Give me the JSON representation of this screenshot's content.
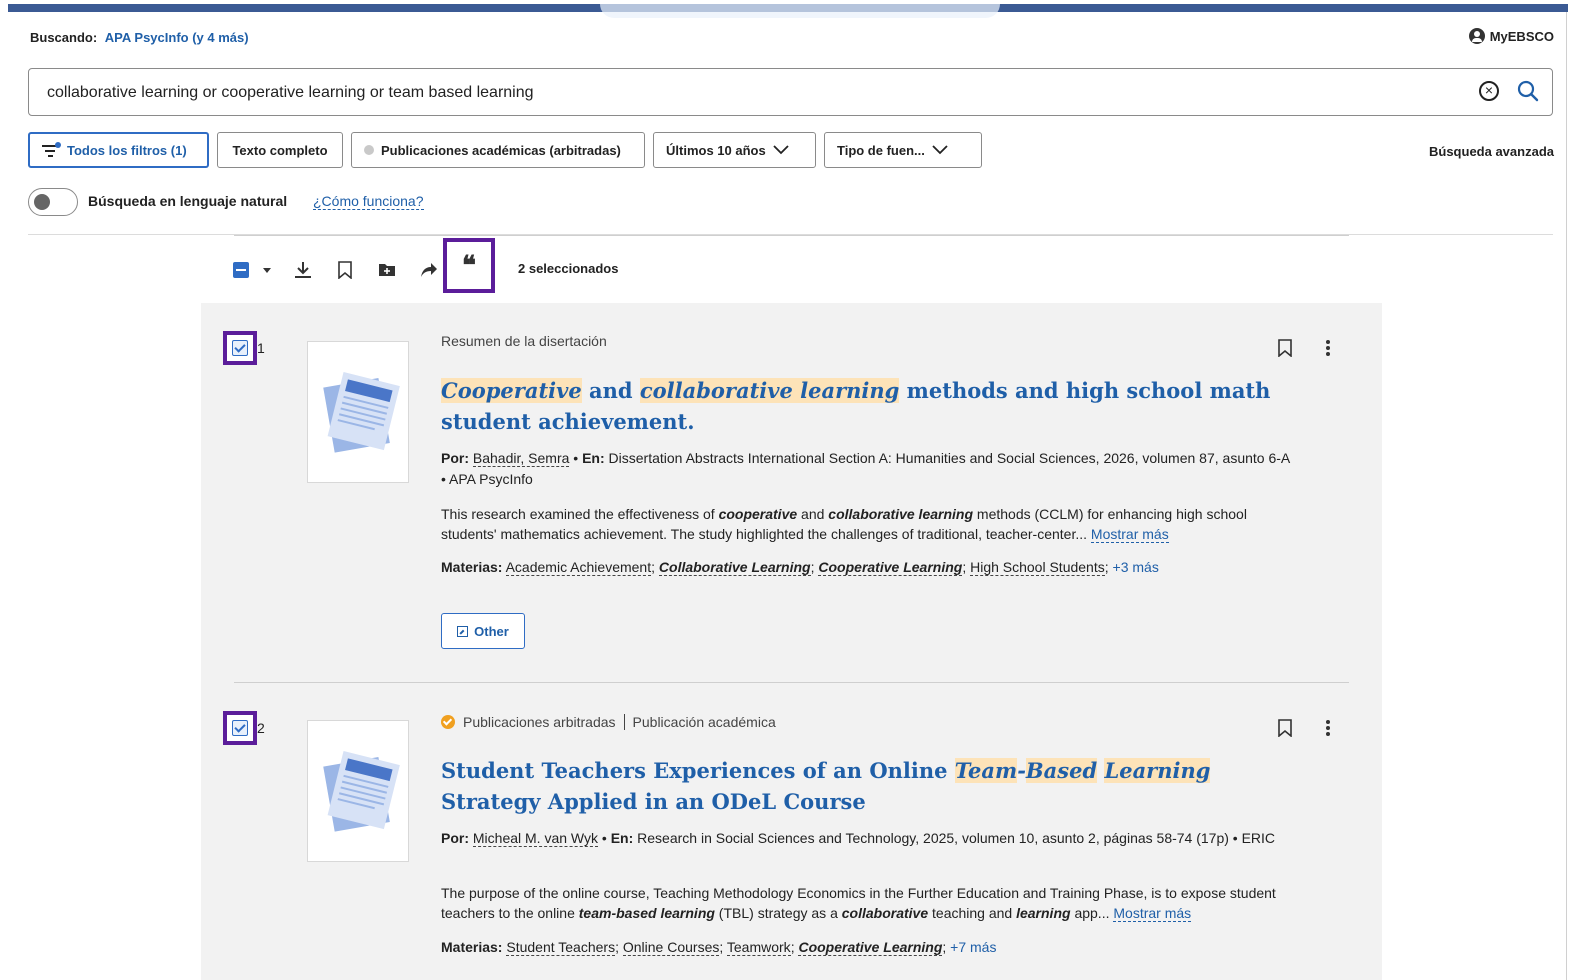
{
  "header": {
    "searching_label": "Buscando:",
    "databases": "APA PsycInfo (y 4 más)",
    "account": "MyEBSCO"
  },
  "search": {
    "query": "collaborative learning or cooperative learning or team based learning"
  },
  "filters": {
    "all_filters": "Todos los filtros (1)",
    "full_text": "Texto completo",
    "peer_reviewed": "Publicaciones académicas (arbitradas)",
    "date_range": "Últimos 10 años",
    "source_type": "Tipo de fuen...",
    "advanced_search": "Búsqueda avanzada"
  },
  "natural_language": {
    "label": "Búsqueda en lenguaje natural",
    "help_link": "¿Cómo funciona?"
  },
  "toolbar": {
    "cite_glyph": "66",
    "selected_count": "2 seleccionados"
  },
  "results": [
    {
      "number": "1",
      "doc_type": "Resumen de la disertación",
      "title_parts": [
        "Cooperative",
        " and ",
        "collaborative learning",
        " methods and high school math student achievement."
      ],
      "by_label": "Por:",
      "author": "Bahadir, Semra",
      "in_label": "En:",
      "source": "Dissertation Abstracts International Section A: Humanities and Social Sciences, 2026, volumen 87, asunto 6-A • APA PsycInfo",
      "abstract_parts": [
        "This research examined the effectiveness of ",
        "cooperative",
        " and ",
        "collaborative learning",
        " methods (CCLM) for enhancing high school students' mathematics achievement. The study highlighted the challenges of traditional, teacher-center..."
      ],
      "show_more": "Mostrar más",
      "subjects_label": "Materias:",
      "subjects": [
        "Academic Achievement",
        "Collaborative Learning",
        "Cooperative Learning",
        "High School Students"
      ],
      "subjects_more": "+3 más",
      "link_button": "Other"
    },
    {
      "number": "2",
      "peer_label": "Publicaciones arbitradas",
      "doc_type": "Publicación académica",
      "title_parts": [
        "Student Teachers Experiences of an Online ",
        "Team",
        "-",
        "Based",
        " ",
        "Learning",
        " Strategy Applied in an ODeL Course"
      ],
      "by_label": "Por:",
      "author": "Micheal M. van Wyk",
      "in_label": "En:",
      "source": "Research in Social Sciences and Technology, 2025, volumen 10, asunto 2, páginas 58-74 (17p) • ERIC",
      "abstract_parts": [
        "The purpose of the online course, Teaching Methodology Economics in the Further Education and Training Phase, is to expose student teachers to the online ",
        "team-based learning",
        " (TBL) strategy as a ",
        "collaborative",
        " teaching and ",
        "learning",
        " app..."
      ],
      "show_more": "Mostrar más",
      "subjects_label": "Materias:",
      "subjects": [
        "Student Teachers",
        "Online Courses",
        "Teamwork",
        "Cooperative Learning"
      ],
      "subjects_more": "+7 más"
    }
  ],
  "colors": {
    "accent": "#1f5fa8",
    "highlight": "#fde3b8",
    "focus_outline": "#5b1d9a",
    "peer_badge": "#f0a020"
  }
}
